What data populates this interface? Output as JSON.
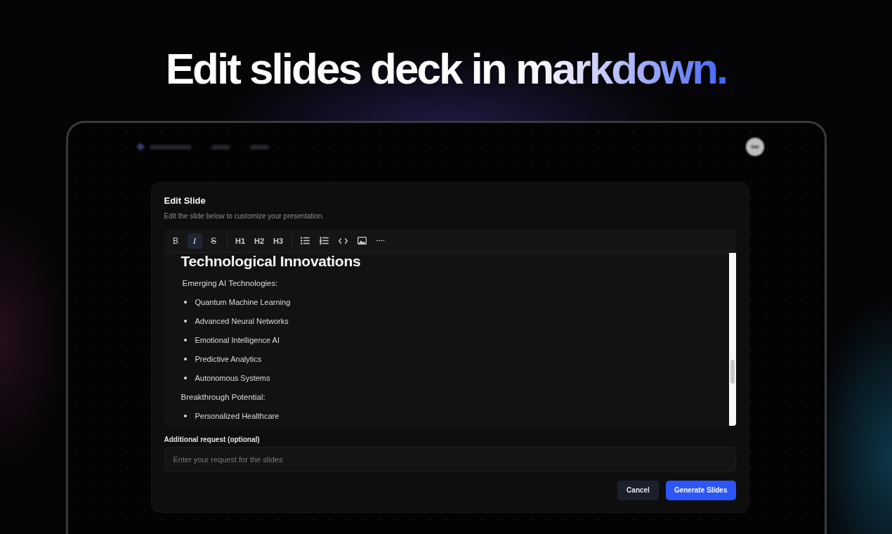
{
  "headline": {
    "text": "Edit slides deck in markdown."
  },
  "dialog": {
    "title": "Edit Slide",
    "description": "Edit the slide below to customize your presentation.",
    "toolbar_groups": [
      {
        "tools": [
          {
            "kind": "bold",
            "label": "B",
            "selected": false
          },
          {
            "kind": "italic",
            "label": "I",
            "selected": true
          },
          {
            "kind": "strike",
            "label": "S",
            "selected": false
          }
        ]
      },
      {
        "tools": [
          {
            "kind": "heading",
            "label": "H1",
            "selected": false
          },
          {
            "kind": "heading",
            "label": "H2",
            "selected": false
          },
          {
            "kind": "heading",
            "label": "H3",
            "selected": false
          }
        ]
      },
      {
        "tools": [
          {
            "kind": "bullet-list",
            "selected": false
          },
          {
            "kind": "ordered-list",
            "selected": false
          },
          {
            "kind": "code",
            "selected": false
          },
          {
            "kind": "image",
            "selected": false
          },
          {
            "kind": "rule",
            "selected": false
          }
        ]
      }
    ],
    "content": [
      {
        "kind": "heading",
        "text": "Technological Innovations"
      },
      {
        "kind": "paragraph",
        "text": "Emerging AI Technologies:"
      },
      {
        "kind": "bullet",
        "text": "Quantum Machine Learning"
      },
      {
        "kind": "bullet",
        "text": "Advanced Neural Networks"
      },
      {
        "kind": "bullet",
        "text": "Emotional Intelligence AI"
      },
      {
        "kind": "bullet",
        "text": "Predictive Analytics"
      },
      {
        "kind": "bullet",
        "text": "Autonomous Systems"
      },
      {
        "kind": "paragraph",
        "text": "Breakthrough Potential:"
      },
      {
        "kind": "bullet",
        "text": "Personalized Healthcare"
      }
    ],
    "request": {
      "label": "Additional request (optional)",
      "placeholder": "Enter your request for the slides"
    },
    "buttons": [
      {
        "kind": "secondary",
        "label": "Cancel"
      },
      {
        "kind": "primary",
        "label": "Generate Slides"
      }
    ]
  }
}
